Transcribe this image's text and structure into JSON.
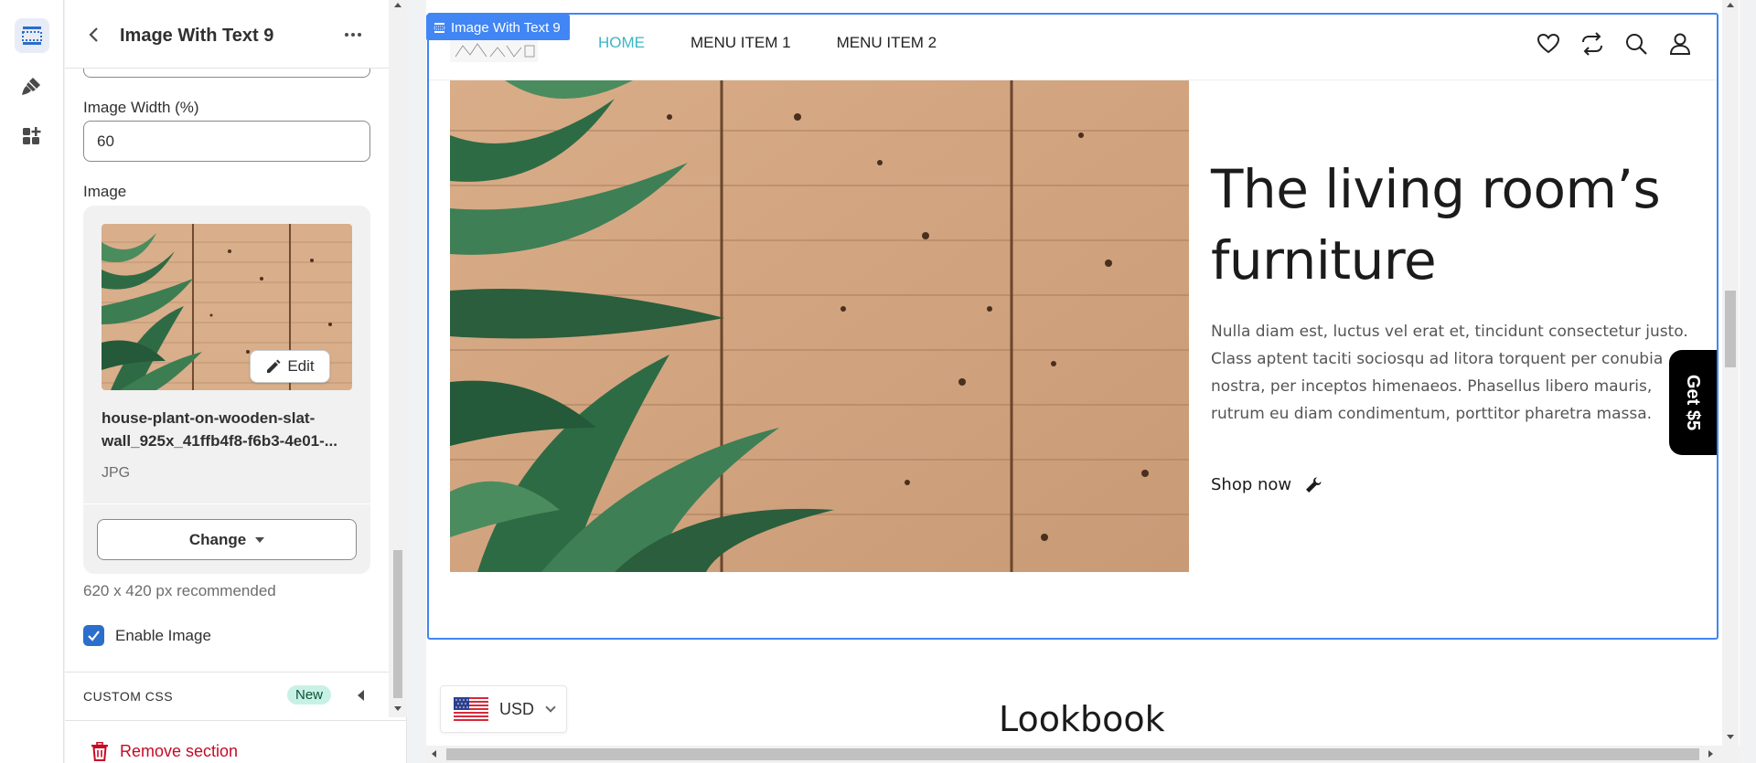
{
  "rail": {
    "items": [
      {
        "icon": "sections-icon",
        "active": true
      },
      {
        "icon": "theme-settings-icon",
        "active": false
      },
      {
        "icon": "app-blocks-icon",
        "active": false
      }
    ]
  },
  "panel": {
    "title": "Image With Text 9",
    "image_width_label": "Image Width (%)",
    "image_width_value": "60",
    "image_label": "Image",
    "edit_label": "Edit",
    "file_name": "house-plant-on-wooden-slat-wall_925x_41ffb4f8-f6b3-4e01-...",
    "file_type": "JPG",
    "change_label": "Change",
    "recommend": "620 x 420 px recommended",
    "enable_image_label": "Enable Image",
    "enable_image_checked": true,
    "custom_css_label": "CUSTOM CSS",
    "new_badge": "New",
    "remove_label": "Remove section"
  },
  "preview": {
    "section_tag": "Image With Text 9",
    "nav": [
      "HOME",
      "MENU ITEM 1",
      "MENU ITEM 2"
    ],
    "nav_icons": [
      "heart-icon",
      "compare-icon",
      "search-icon",
      "account-icon"
    ],
    "hero_title": "The living room’s furniture",
    "hero_body": "Nulla diam est, luctus vel erat et, tincidunt consectetur justo. Class aptent taciti sociosqu ad litora torquent per conubia nostra, per inceptos himenaeos. Phasellus libero mauris, rutrum eu diam condimentum, porttitor pharetra massa.",
    "shop_now": "Shop now",
    "get5_label": "Get $5",
    "currency": "USD",
    "lookbook": "Lookbook",
    "colors": {
      "accent_nav": "#3bb7c3",
      "selection": "#4285f4",
      "remove": "#c70a24"
    }
  }
}
